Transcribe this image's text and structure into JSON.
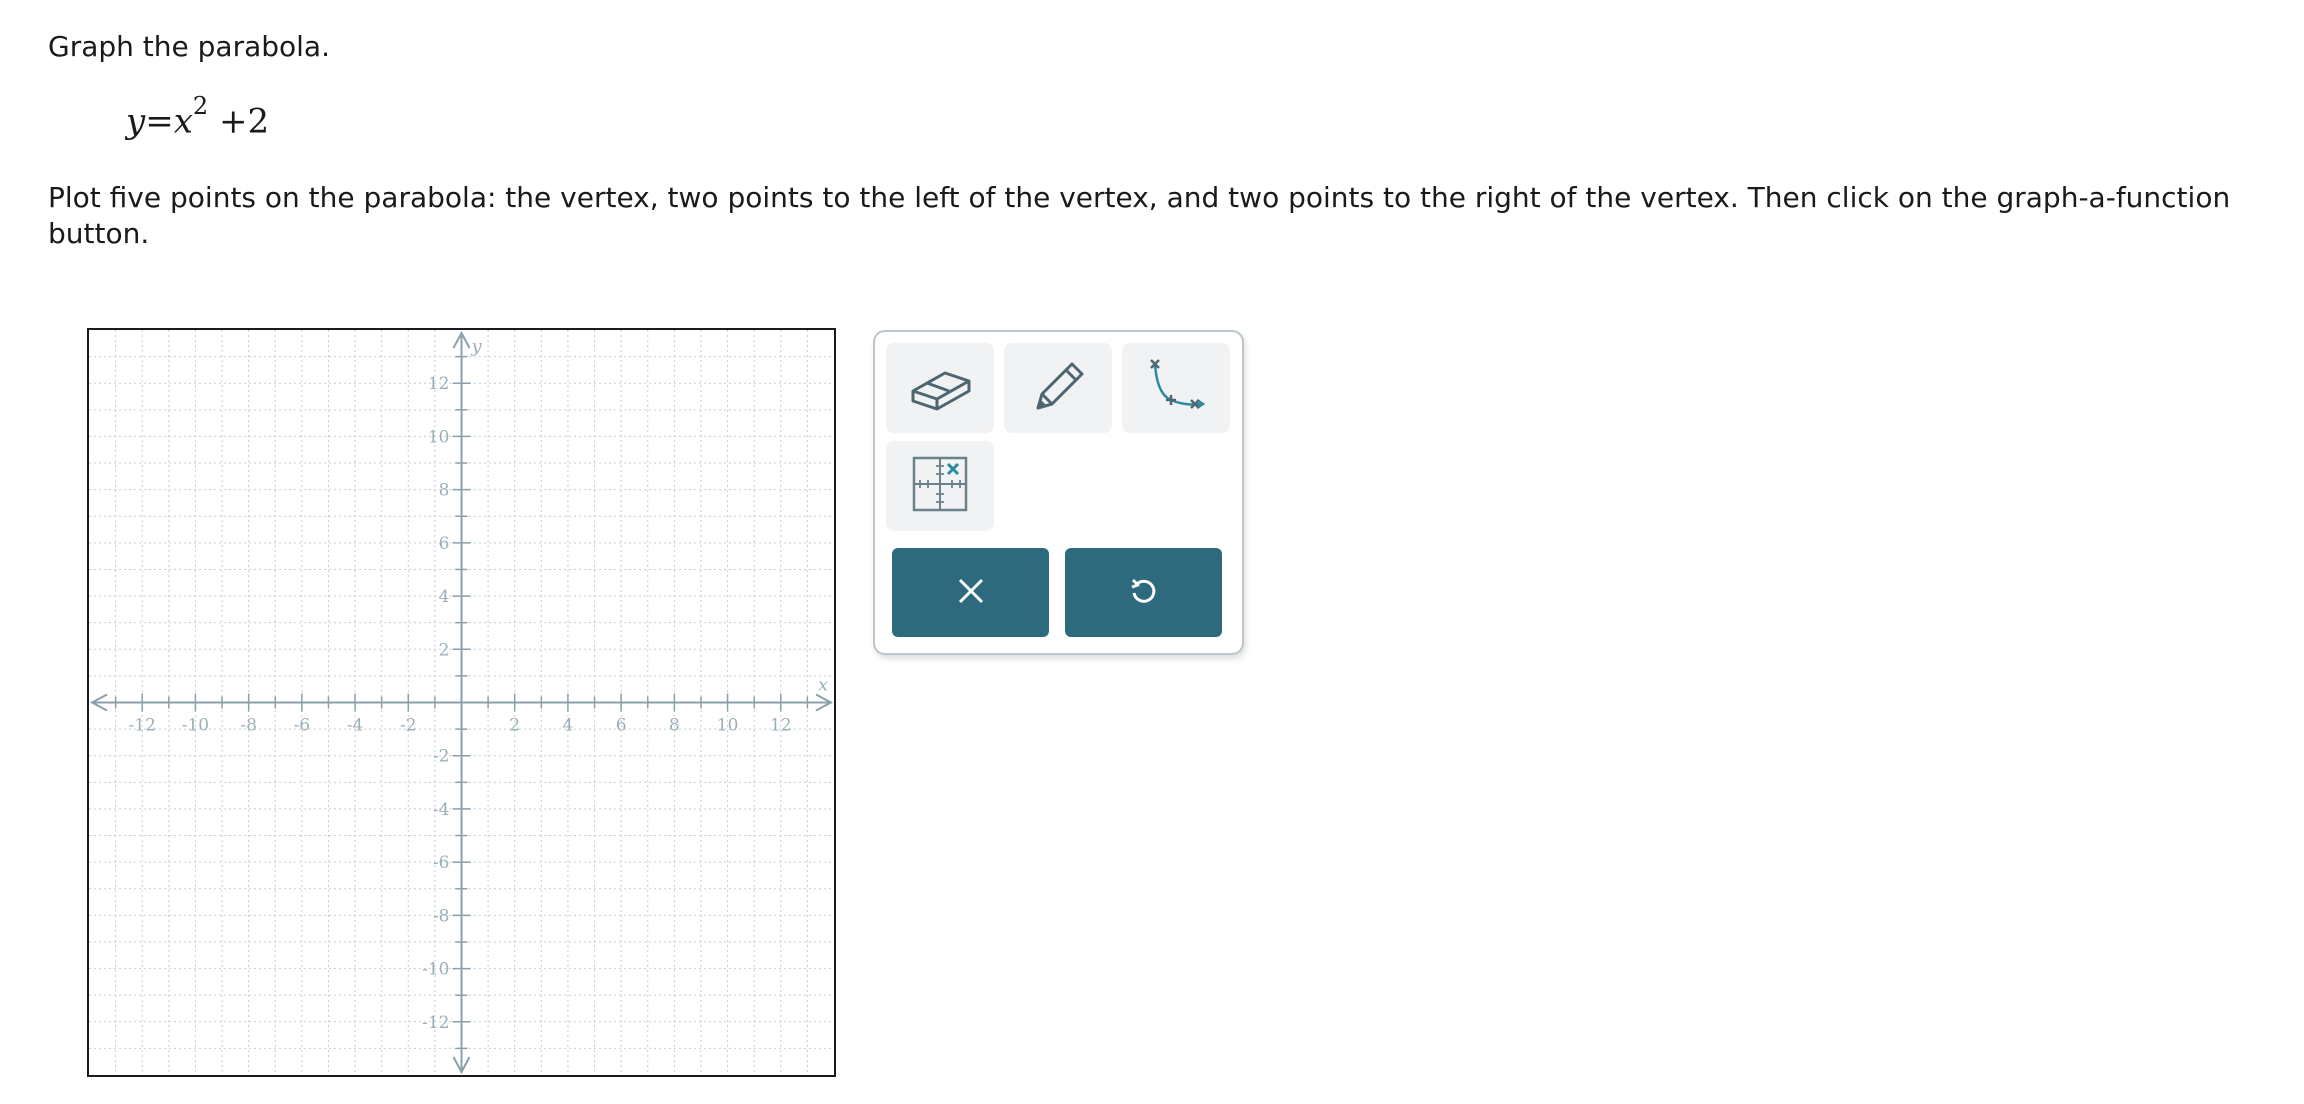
{
  "problem": {
    "prompt": "Graph the parabola.",
    "equation": {
      "lhs": "y",
      "equals": "=",
      "base": "x",
      "exponent": "2",
      "rest": "+2"
    },
    "instructions": "Plot five points on the parabola: the vertex, two points to the left of the vertex, and two points to the right of the vertex. Then click on the graph-a-function button."
  },
  "graph": {
    "x_axis_label": "x",
    "y_axis_label": "y",
    "range": {
      "xmin": -14,
      "xmax": 14,
      "ymin": -14,
      "ymax": 14
    },
    "grid_step": 1,
    "tick_label_step": 2,
    "x_tick_labels": [
      "-12",
      "-10",
      "-8",
      "-6",
      "-4",
      "-2",
      "2",
      "4",
      "6",
      "8",
      "10",
      "12"
    ],
    "y_tick_labels": [
      "12",
      "10",
      "8",
      "6",
      "4",
      "2",
      "-2",
      "-4",
      "-6",
      "-8",
      "-10",
      "-12"
    ],
    "grid": "dotted",
    "colors": {
      "axis": "#8aa1ab",
      "grid": "#c3cdd2",
      "tick_label": "#9aafb8"
    }
  },
  "toolbox": {
    "tools": [
      {
        "name": "eraser",
        "icon": "eraser-icon"
      },
      {
        "name": "pencil",
        "icon": "pencil-icon"
      },
      {
        "name": "graph-a-function",
        "icon": "graph-function-icon"
      },
      {
        "name": "point-grid",
        "icon": "point-grid-icon"
      }
    ],
    "actions": [
      {
        "name": "clear",
        "icon": "close-icon"
      },
      {
        "name": "undo",
        "icon": "undo-icon"
      }
    ],
    "colors": {
      "button": "#2e6a7e",
      "tool_bg": "#f0f2f3",
      "border": "#b9c6cc",
      "icon": "#4d6670",
      "accent": "#2d8aa0"
    }
  }
}
